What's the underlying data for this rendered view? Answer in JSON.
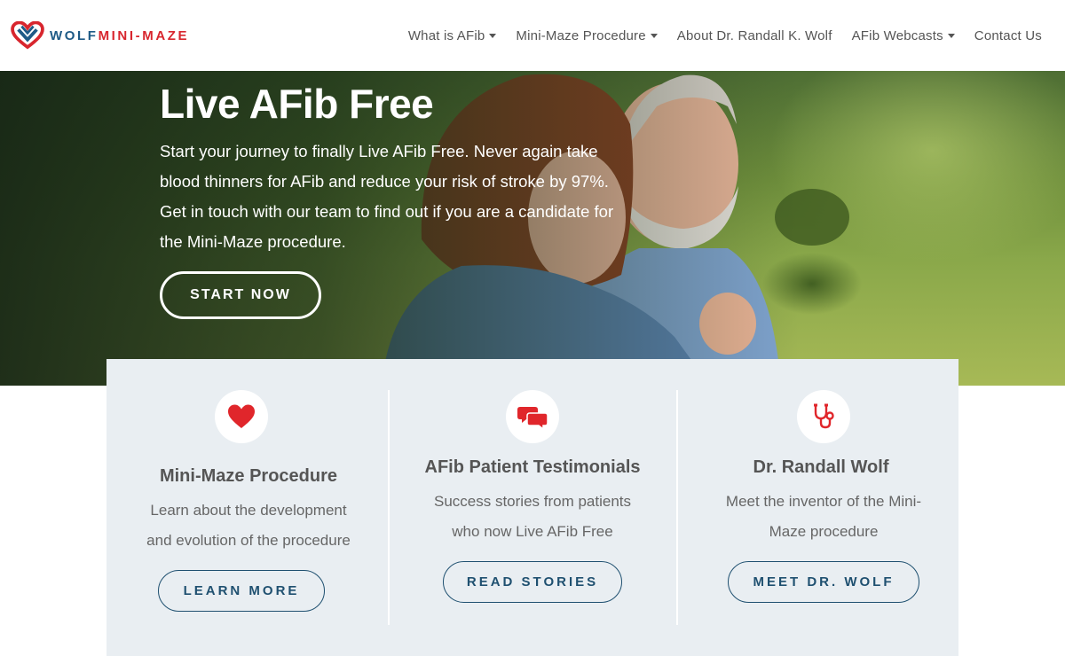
{
  "brand": {
    "part1": "WOLF",
    "part2": "MINI-MAZE",
    "color_primary": "#1e5a86",
    "color_accent": "#d8262e"
  },
  "nav": {
    "items": [
      {
        "label": "What is AFib",
        "dropdown": true
      },
      {
        "label": "Mini-Maze Procedure",
        "dropdown": true
      },
      {
        "label": "About Dr. Randall K. Wolf",
        "dropdown": false
      },
      {
        "label": "AFib Webcasts",
        "dropdown": true
      },
      {
        "label": "Contact Us",
        "dropdown": false
      }
    ]
  },
  "hero": {
    "title": "Live AFib Free",
    "line1": "Start your journey to finally Live AFib Free. Never again take",
    "line2": "blood thinners for AFib and reduce your risk of stroke by 97%.",
    "line3": "Get in touch with our team to find out if you are a candidate for",
    "line4": "the Mini-Maze procedure.",
    "button": "START NOW"
  },
  "cards": [
    {
      "icon": "heart-icon",
      "title": "Mini-Maze Procedure",
      "line1": "Learn about the development",
      "line2": "and evolution of the procedure",
      "button": "LEARN MORE"
    },
    {
      "icon": "chat-bubbles-icon",
      "title": "AFib Patient Testimonials",
      "line1": "Success stories from patients",
      "line2": "who now Live AFib Free",
      "button": "READ STORIES"
    },
    {
      "icon": "stethoscope-icon",
      "title": "Dr. Randall Wolf",
      "line1": "Meet the inventor of the Mini-",
      "line2": "Maze procedure",
      "button": "MEET DR. WOLF"
    }
  ],
  "colors": {
    "icon_red": "#e0262b",
    "button_blue": "#1f5070",
    "card_bg": "#e9eef2"
  }
}
